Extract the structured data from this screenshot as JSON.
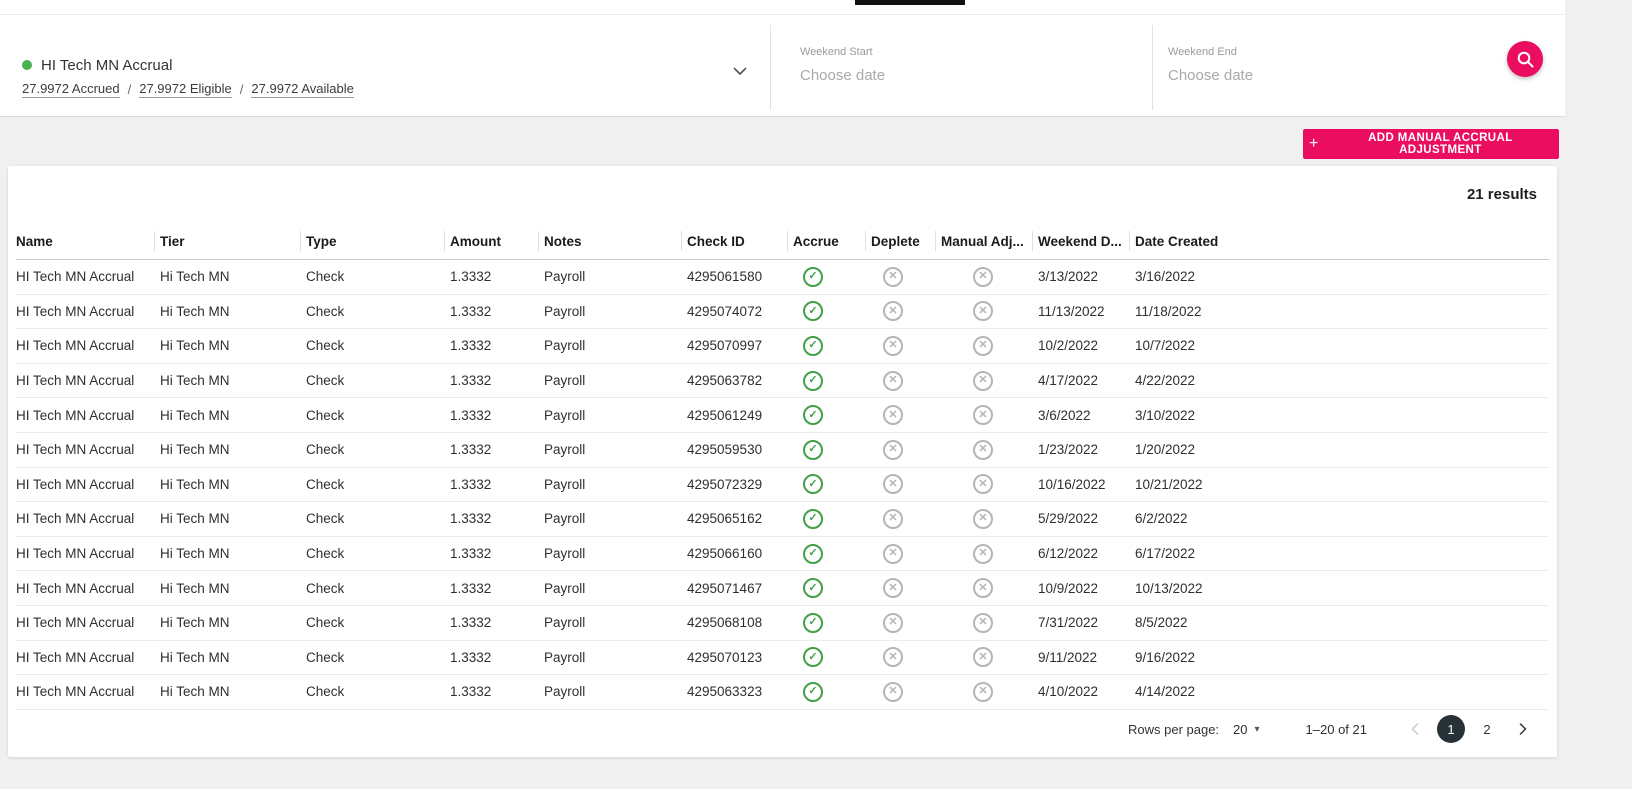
{
  "colors": {
    "accent_pink": "#eb0d5f",
    "success_green": "#43a047",
    "inactive_gray": "#b5b5b5",
    "current_page_dark": "#263238",
    "status_dot_green": "#4caf50"
  },
  "header": {
    "selector": {
      "title": "HI Tech MN Accrual",
      "stats": [
        {
          "value": "27.9972",
          "label": "Accrued"
        },
        {
          "value": "27.9972",
          "label": "Eligible"
        },
        {
          "value": "27.9972",
          "label": "Available"
        }
      ],
      "separator": "/"
    },
    "weekend_start": {
      "label": "Weekend Start",
      "placeholder": "Choose date"
    },
    "weekend_end": {
      "label": "Weekend End",
      "placeholder": "Choose date"
    }
  },
  "toolbar": {
    "add_button_label": "ADD MANUAL ACCRUAL ADJUSTMENT"
  },
  "table": {
    "results_label": "21 results",
    "columns": [
      "Name",
      "Tier",
      "Type",
      "Amount",
      "Notes",
      "Check ID",
      "Accrue",
      "Deplete",
      "Manual Adj...",
      "Weekend D...",
      "Date Created"
    ],
    "rows": [
      {
        "name": "HI Tech MN Accrual",
        "tier": "Hi Tech MN",
        "type": "Check",
        "amount": "1.3332",
        "notes": "Payroll",
        "check_id": "4295061580",
        "accrue": true,
        "deplete": false,
        "manual_adj": false,
        "weekend_date": "3/13/2022",
        "date_created": "3/16/2022"
      },
      {
        "name": "HI Tech MN Accrual",
        "tier": "Hi Tech MN",
        "type": "Check",
        "amount": "1.3332",
        "notes": "Payroll",
        "check_id": "4295074072",
        "accrue": true,
        "deplete": false,
        "manual_adj": false,
        "weekend_date": "11/13/2022",
        "date_created": "11/18/2022"
      },
      {
        "name": "HI Tech MN Accrual",
        "tier": "Hi Tech MN",
        "type": "Check",
        "amount": "1.3332",
        "notes": "Payroll",
        "check_id": "4295070997",
        "accrue": true,
        "deplete": false,
        "manual_adj": false,
        "weekend_date": "10/2/2022",
        "date_created": "10/7/2022"
      },
      {
        "name": "HI Tech MN Accrual",
        "tier": "Hi Tech MN",
        "type": "Check",
        "amount": "1.3332",
        "notes": "Payroll",
        "check_id": "4295063782",
        "accrue": true,
        "deplete": false,
        "manual_adj": false,
        "weekend_date": "4/17/2022",
        "date_created": "4/22/2022"
      },
      {
        "name": "HI Tech MN Accrual",
        "tier": "Hi Tech MN",
        "type": "Check",
        "amount": "1.3332",
        "notes": "Payroll",
        "check_id": "4295061249",
        "accrue": true,
        "deplete": false,
        "manual_adj": false,
        "weekend_date": "3/6/2022",
        "date_created": "3/10/2022"
      },
      {
        "name": "HI Tech MN Accrual",
        "tier": "Hi Tech MN",
        "type": "Check",
        "amount": "1.3332",
        "notes": "Payroll",
        "check_id": "4295059530",
        "accrue": true,
        "deplete": false,
        "manual_adj": false,
        "weekend_date": "1/23/2022",
        "date_created": "1/20/2022"
      },
      {
        "name": "HI Tech MN Accrual",
        "tier": "Hi Tech MN",
        "type": "Check",
        "amount": "1.3332",
        "notes": "Payroll",
        "check_id": "4295072329",
        "accrue": true,
        "deplete": false,
        "manual_adj": false,
        "weekend_date": "10/16/2022",
        "date_created": "10/21/2022"
      },
      {
        "name": "HI Tech MN Accrual",
        "tier": "Hi Tech MN",
        "type": "Check",
        "amount": "1.3332",
        "notes": "Payroll",
        "check_id": "4295065162",
        "accrue": true,
        "deplete": false,
        "manual_adj": false,
        "weekend_date": "5/29/2022",
        "date_created": "6/2/2022"
      },
      {
        "name": "HI Tech MN Accrual",
        "tier": "Hi Tech MN",
        "type": "Check",
        "amount": "1.3332",
        "notes": "Payroll",
        "check_id": "4295066160",
        "accrue": true,
        "deplete": false,
        "manual_adj": false,
        "weekend_date": "6/12/2022",
        "date_created": "6/17/2022"
      },
      {
        "name": "HI Tech MN Accrual",
        "tier": "Hi Tech MN",
        "type": "Check",
        "amount": "1.3332",
        "notes": "Payroll",
        "check_id": "4295071467",
        "accrue": true,
        "deplete": false,
        "manual_adj": false,
        "weekend_date": "10/9/2022",
        "date_created": "10/13/2022"
      },
      {
        "name": "HI Tech MN Accrual",
        "tier": "Hi Tech MN",
        "type": "Check",
        "amount": "1.3332",
        "notes": "Payroll",
        "check_id": "4295068108",
        "accrue": true,
        "deplete": false,
        "manual_adj": false,
        "weekend_date": "7/31/2022",
        "date_created": "8/5/2022"
      },
      {
        "name": "HI Tech MN Accrual",
        "tier": "Hi Tech MN",
        "type": "Check",
        "amount": "1.3332",
        "notes": "Payroll",
        "check_id": "4295070123",
        "accrue": true,
        "deplete": false,
        "manual_adj": false,
        "weekend_date": "9/11/2022",
        "date_created": "9/16/2022"
      },
      {
        "name": "HI Tech MN Accrual",
        "tier": "Hi Tech MN",
        "type": "Check",
        "amount": "1.3332",
        "notes": "Payroll",
        "check_id": "4295063323",
        "accrue": true,
        "deplete": false,
        "manual_adj": false,
        "weekend_date": "4/10/2022",
        "date_created": "4/14/2022"
      }
    ]
  },
  "pagination": {
    "rows_per_page_label": "Rows per page:",
    "rows_per_page_value": "20",
    "range_label": "1–20 of 21",
    "pages": [
      "1",
      "2"
    ],
    "current_page": "1"
  }
}
